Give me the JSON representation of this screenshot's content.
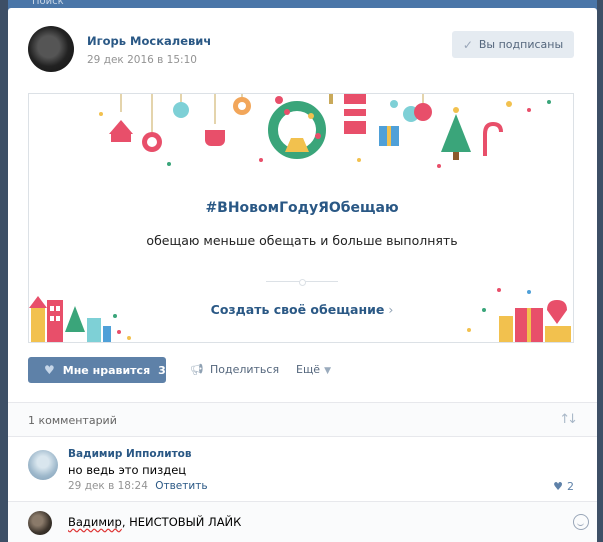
{
  "background": {
    "search_label": "Поиск"
  },
  "post": {
    "author_name": "Игорь Москалевич",
    "date": "29 дек 2016 в 15:10",
    "subscribe_label": "Вы подписаны",
    "card": {
      "hashtag": "#ВНовомГодуЯОбещаю",
      "promise": "обещаю меньше обещать и больше выполнять",
      "create_link": "Создать своё обещание"
    },
    "actions": {
      "like_label": "Мне нравится",
      "like_count": "3",
      "share_label": "Поделиться",
      "more_label": "Ещё"
    }
  },
  "comments": {
    "count_label": "1 комментарий",
    "items": [
      {
        "author": "Вадимир Ипполитов",
        "text": "но ведь это пиздец",
        "date": "29 дек в 18:24",
        "reply_label": "Ответить",
        "likes": "2"
      }
    ]
  },
  "reply": {
    "mention": "Вадимир",
    "text": ", НЕИСТОВЫЙ ЛАЙК"
  },
  "colors": {
    "link": "#2a5885",
    "like_button": "#5e81a8",
    "page_bg": "#4a76a8"
  }
}
